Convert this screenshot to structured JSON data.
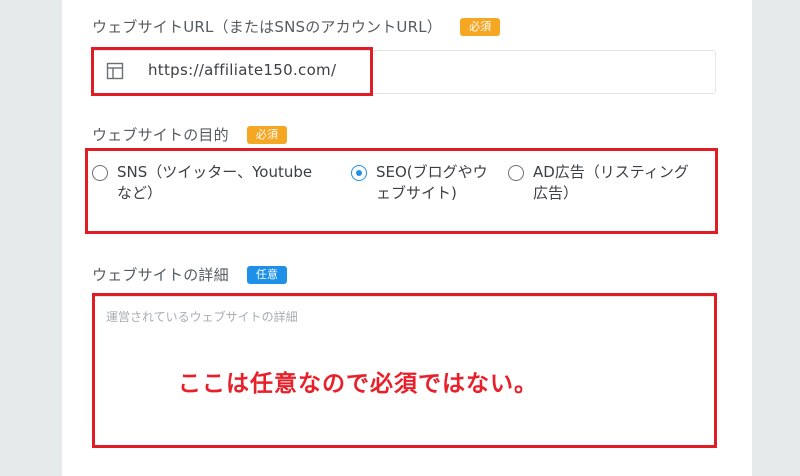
{
  "form": {
    "website_url": {
      "label": "ウェブサイトURL（またはSNSのアカウントURL）",
      "badge": "必須",
      "value": "https://affiliate150.com/",
      "icon": "layout-icon"
    },
    "purpose": {
      "label": "ウェブサイトの目的",
      "badge": "必須",
      "options": [
        {
          "line1": "SNS（ツイッター、Youtube",
          "line2": "など）",
          "checked": false
        },
        {
          "line1": "SEO(ブログやウ",
          "line2": "ェブサイト)",
          "checked": true
        },
        {
          "line1": "AD広告（リスティング",
          "line2": "広告）",
          "checked": false
        }
      ]
    },
    "details": {
      "label": "ウェブサイトの詳細",
      "badge": "任意",
      "placeholder": "運営されているウェブサイトの詳細"
    }
  },
  "annotation": {
    "text": "ここは任意なので必須ではない。",
    "color": "#e01d25"
  },
  "colors": {
    "required_badge": "#f5a623",
    "optional_badge": "#1e90e8",
    "radio_selected": "#1e90e8"
  }
}
